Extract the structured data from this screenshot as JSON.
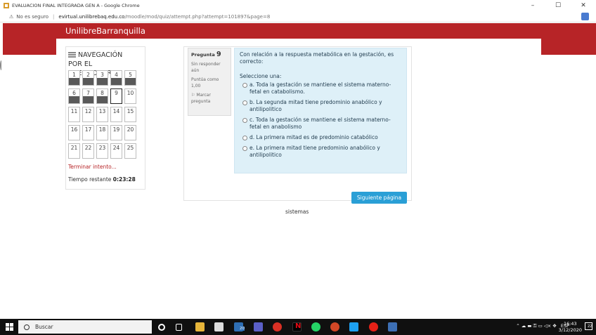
{
  "browser": {
    "window_title": "EVALUACION FINAL INTEGRADA GEN A - Google Chrome",
    "security_label": "No es seguro",
    "url_host": "evirtual.unilibrebaq.edu.co",
    "url_path": "/moodle/mod/quiz/attempt.php?attempt=101897&page=8"
  },
  "site": {
    "name": "UnilibreBarranquilla"
  },
  "navigation": {
    "title_line1": "NAVEGACIÓN",
    "title_line2": "POR EL CUESTIONARIO",
    "questions": [
      {
        "n": "1",
        "answered": true
      },
      {
        "n": "2",
        "answered": true
      },
      {
        "n": "3",
        "answered": true
      },
      {
        "n": "4",
        "answered": true
      },
      {
        "n": "5",
        "answered": true
      },
      {
        "n": "6",
        "answered": true
      },
      {
        "n": "7",
        "answered": true
      },
      {
        "n": "8",
        "answered": true
      },
      {
        "n": "9",
        "answered": false,
        "current": true
      },
      {
        "n": "10",
        "answered": false
      },
      {
        "n": "11",
        "answered": false
      },
      {
        "n": "12",
        "answered": false
      },
      {
        "n": "13",
        "answered": false
      },
      {
        "n": "14",
        "answered": false
      },
      {
        "n": "15",
        "answered": false
      },
      {
        "n": "16",
        "answered": false
      },
      {
        "n": "17",
        "answered": false
      },
      {
        "n": "18",
        "answered": false
      },
      {
        "n": "19",
        "answered": false
      },
      {
        "n": "20",
        "answered": false
      },
      {
        "n": "21",
        "answered": false
      },
      {
        "n": "22",
        "answered": false
      },
      {
        "n": "23",
        "answered": false
      },
      {
        "n": "24",
        "answered": false
      },
      {
        "n": "25",
        "answered": false
      }
    ],
    "finish_link": "Terminar intento...",
    "time_label": "Tiempo restante",
    "time_value": "0:23:28"
  },
  "question": {
    "label": "Pregunta",
    "number": "9",
    "status": "Sin responder aún",
    "grade": "Puntúa como 1,00",
    "flag": "Marcar pregunta",
    "text": "Con relación a la respuesta metabólica en la gestación, es correcto:",
    "prompt": "Seleccione una:",
    "options": [
      "a. Toda la gestación se mantiene  el sistema materno-fetal en catabolismo.",
      "b. La segunda mitad tiene predominio anabólico y antilipolitico",
      "c. Toda la gestación se mantiene el sistema materno-fetal en anabolismo",
      "d. La primera mitad es de predominio catabólico",
      "e. La primera mitad tiene predominio anabólico y antilipolitico"
    ],
    "next_button": "Siguiente página"
  },
  "footer_text": "sistemas",
  "taskbar": {
    "search_placeholder": "Buscar",
    "language": "ESP",
    "time": "16:43",
    "date": "3/12/2020",
    "badge": "20",
    "notifications": "22"
  },
  "colors": {
    "brand_red": "#b72427",
    "accent_blue": "#2a9fd6",
    "question_bg": "#def0f8"
  }
}
